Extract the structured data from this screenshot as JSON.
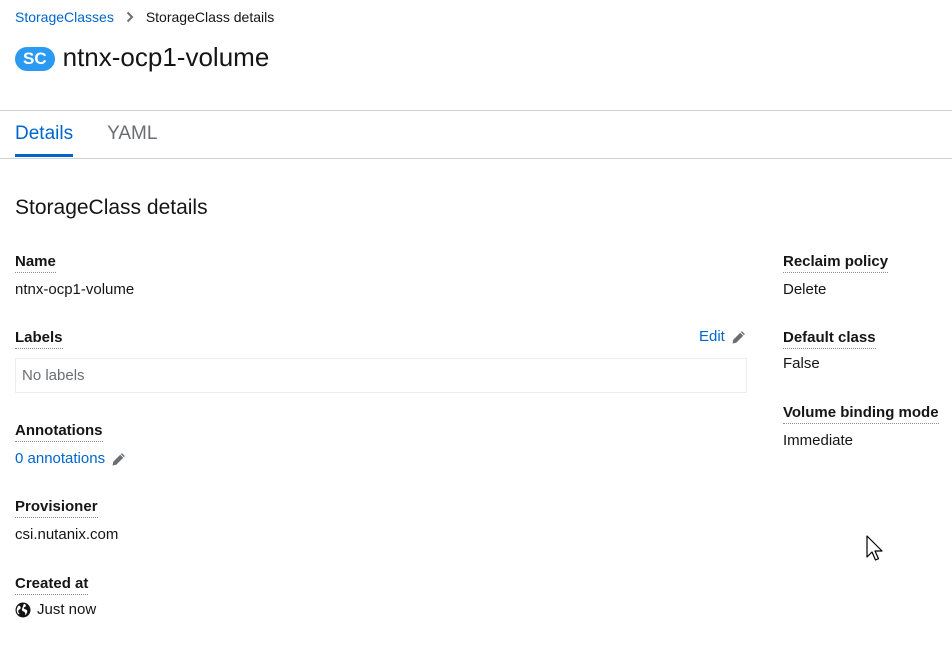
{
  "breadcrumb": {
    "parent_label": "StorageClasses",
    "current_label": "StorageClass details"
  },
  "header": {
    "badge": "SC",
    "title": "ntnx-ocp1-volume"
  },
  "tabs": [
    {
      "label": "Details",
      "active": true
    },
    {
      "label": "YAML",
      "active": false
    }
  ],
  "section": {
    "title": "StorageClass details"
  },
  "details": {
    "name_label": "Name",
    "name_value": "ntnx-ocp1-volume",
    "labels_label": "Labels",
    "labels_edit": "Edit",
    "labels_empty": "No labels",
    "annotations_label": "Annotations",
    "annotations_link": "0 annotations",
    "provisioner_label": "Provisioner",
    "provisioner_value": "csi.nutanix.com",
    "created_label": "Created at",
    "created_value": "Just now",
    "reclaim_label": "Reclaim policy",
    "reclaim_value": "Delete",
    "default_label": "Default class",
    "default_value": "False",
    "binding_label": "Volume binding mode",
    "binding_value": "Immediate"
  },
  "icons": {
    "breadcrumb_separator": "chevron-right-icon",
    "edit": "pencil-icon",
    "created": "globe-icon",
    "pointer": "mouse-cursor-icon"
  },
  "colors": {
    "link": "#0066cc",
    "badge": "#2b9af3",
    "border": "#d2d2d2"
  }
}
